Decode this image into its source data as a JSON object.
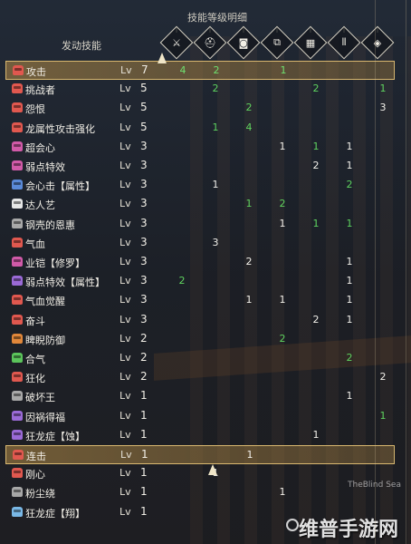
{
  "header": {
    "title": "技能等级明细",
    "column_label": "发动技能",
    "equipment_icons": [
      "weapon-icon",
      "head-armor-icon",
      "chest-armor-icon",
      "arm-armor-icon",
      "waist-armor-icon",
      "leg-armor-icon",
      "charm-icon"
    ]
  },
  "colors": {
    "accent": "#d9b870",
    "green_value": "#5fd35f",
    "white_value": "#f2f0ea",
    "icon_red": "#e0584f",
    "icon_pink": "#d05aa8",
    "icon_purple": "#9a6ad6",
    "icon_blue": "#5a8ad8",
    "icon_white": "#e6e6e6",
    "icon_gray": "#a8a8a8",
    "icon_green": "#5bc45b",
    "icon_yellow": "#e6c35a",
    "icon_orange": "#e0873a",
    "icon_lightblue": "#7ab8e6"
  },
  "lv_label": "Lv",
  "skills": [
    {
      "name": "攻击",
      "icon": "red",
      "level": "7",
      "selected": true,
      "cells": [
        [
          "4",
          "green"
        ],
        [
          "2",
          "green"
        ],
        [
          "",
          ""
        ],
        [
          "1",
          "green"
        ],
        [
          "",
          ""
        ],
        [
          "",
          ""
        ],
        [
          "",
          ""
        ]
      ]
    },
    {
      "name": "挑战者",
      "icon": "red",
      "level": "5",
      "selected": false,
      "cells": [
        [
          "",
          ""
        ],
        [
          "2",
          "green"
        ],
        [
          "",
          ""
        ],
        [
          "",
          ""
        ],
        [
          "2",
          "green"
        ],
        [
          "",
          ""
        ],
        [
          "1",
          "green"
        ]
      ]
    },
    {
      "name": "怨恨",
      "icon": "red",
      "level": "5",
      "selected": false,
      "cells": [
        [
          "",
          ""
        ],
        [
          "",
          ""
        ],
        [
          "2",
          "green"
        ],
        [
          "",
          ""
        ],
        [
          "",
          ""
        ],
        [
          "",
          ""
        ],
        [
          "3",
          "white"
        ]
      ]
    },
    {
      "name": "龙属性攻击强化",
      "icon": "red",
      "level": "5",
      "selected": false,
      "cells": [
        [
          "",
          ""
        ],
        [
          "1",
          "green"
        ],
        [
          "4",
          "green"
        ],
        [
          "",
          ""
        ],
        [
          "",
          ""
        ],
        [
          "",
          ""
        ],
        [
          "",
          ""
        ]
      ]
    },
    {
      "name": "超会心",
      "icon": "pink",
      "level": "3",
      "selected": false,
      "cells": [
        [
          "",
          ""
        ],
        [
          "",
          ""
        ],
        [
          "",
          ""
        ],
        [
          "1",
          "white"
        ],
        [
          "1",
          "green"
        ],
        [
          "1",
          "white"
        ],
        [
          "",
          ""
        ]
      ]
    },
    {
      "name": "弱点特效",
      "icon": "pink",
      "level": "3",
      "selected": false,
      "cells": [
        [
          "",
          ""
        ],
        [
          "",
          ""
        ],
        [
          "",
          ""
        ],
        [
          "",
          ""
        ],
        [
          "2",
          "white"
        ],
        [
          "1",
          "white"
        ],
        [
          "",
          ""
        ]
      ]
    },
    {
      "name": "会心击【属性】",
      "icon": "blue",
      "level": "3",
      "selected": false,
      "cells": [
        [
          "",
          ""
        ],
        [
          "1",
          "white"
        ],
        [
          "",
          ""
        ],
        [
          "",
          ""
        ],
        [
          "",
          ""
        ],
        [
          "2",
          "green"
        ],
        [
          "",
          ""
        ]
      ]
    },
    {
      "name": "达人艺",
      "icon": "white",
      "level": "3",
      "selected": false,
      "cells": [
        [
          "",
          ""
        ],
        [
          "",
          ""
        ],
        [
          "1",
          "green"
        ],
        [
          "2",
          "green"
        ],
        [
          "",
          ""
        ],
        [
          "",
          ""
        ],
        [
          "",
          ""
        ]
      ]
    },
    {
      "name": "钢壳的恩惠",
      "icon": "gray",
      "level": "3",
      "selected": false,
      "cells": [
        [
          "",
          ""
        ],
        [
          "",
          ""
        ],
        [
          "",
          ""
        ],
        [
          "1",
          "white"
        ],
        [
          "1",
          "green"
        ],
        [
          "1",
          "green"
        ],
        [
          "",
          ""
        ]
      ]
    },
    {
      "name": "气血",
      "icon": "red",
      "level": "3",
      "selected": false,
      "cells": [
        [
          "",
          ""
        ],
        [
          "3",
          "white"
        ],
        [
          "",
          ""
        ],
        [
          "",
          ""
        ],
        [
          "",
          ""
        ],
        [
          "",
          ""
        ],
        [
          "",
          ""
        ]
      ]
    },
    {
      "name": "业铠【修罗】",
      "icon": "pink",
      "level": "3",
      "selected": false,
      "cells": [
        [
          "",
          ""
        ],
        [
          "",
          ""
        ],
        [
          "2",
          "white"
        ],
        [
          "",
          ""
        ],
        [
          "",
          ""
        ],
        [
          "1",
          "white"
        ],
        [
          "",
          ""
        ]
      ]
    },
    {
      "name": "弱点特效【属性】",
      "icon": "purple",
      "level": "3",
      "selected": false,
      "cells": [
        [
          "2",
          "green"
        ],
        [
          "",
          ""
        ],
        [
          "",
          ""
        ],
        [
          "",
          ""
        ],
        [
          "",
          ""
        ],
        [
          "1",
          "white"
        ],
        [
          "",
          ""
        ]
      ]
    },
    {
      "name": "气血觉醒",
      "icon": "red",
      "level": "3",
      "selected": false,
      "cells": [
        [
          "",
          ""
        ],
        [
          "",
          ""
        ],
        [
          "1",
          "white"
        ],
        [
          "1",
          "white"
        ],
        [
          "",
          ""
        ],
        [
          "1",
          "white"
        ],
        [
          "",
          ""
        ]
      ]
    },
    {
      "name": "奋斗",
      "icon": "red",
      "level": "3",
      "selected": false,
      "cells": [
        [
          "",
          ""
        ],
        [
          "",
          ""
        ],
        [
          "",
          ""
        ],
        [
          "",
          ""
        ],
        [
          "2",
          "white"
        ],
        [
          "1",
          "white"
        ],
        [
          "",
          ""
        ]
      ]
    },
    {
      "name": "睥睨防御",
      "icon": "orange",
      "level": "2",
      "selected": false,
      "cells": [
        [
          "",
          ""
        ],
        [
          "",
          ""
        ],
        [
          "",
          ""
        ],
        [
          "2",
          "green"
        ],
        [
          "",
          ""
        ],
        [
          "",
          ""
        ],
        [
          "",
          ""
        ]
      ]
    },
    {
      "name": "合气",
      "icon": "green",
      "level": "2",
      "selected": false,
      "cells": [
        [
          "",
          ""
        ],
        [
          "",
          ""
        ],
        [
          "",
          ""
        ],
        [
          "",
          ""
        ],
        [
          "",
          ""
        ],
        [
          "2",
          "green"
        ],
        [
          "",
          ""
        ]
      ]
    },
    {
      "name": "狂化",
      "icon": "red",
      "level": "2",
      "selected": false,
      "cells": [
        [
          "",
          ""
        ],
        [
          "",
          ""
        ],
        [
          "",
          ""
        ],
        [
          "",
          ""
        ],
        [
          "",
          ""
        ],
        [
          "",
          ""
        ],
        [
          "2",
          "white"
        ]
      ]
    },
    {
      "name": "破坏王",
      "icon": "gray",
      "level": "1",
      "selected": false,
      "cells": [
        [
          "",
          ""
        ],
        [
          "",
          ""
        ],
        [
          "",
          ""
        ],
        [
          "",
          ""
        ],
        [
          "",
          ""
        ],
        [
          "1",
          "white"
        ],
        [
          "",
          ""
        ]
      ]
    },
    {
      "name": "因祸得福",
      "icon": "purple",
      "level": "1",
      "selected": false,
      "cells": [
        [
          "",
          ""
        ],
        [
          "",
          ""
        ],
        [
          "",
          ""
        ],
        [
          "",
          ""
        ],
        [
          "",
          ""
        ],
        [
          "",
          ""
        ],
        [
          "1",
          "green"
        ]
      ]
    },
    {
      "name": "狂龙症【蚀】",
      "icon": "purple",
      "level": "1",
      "selected": false,
      "cells": [
        [
          "",
          ""
        ],
        [
          "",
          ""
        ],
        [
          "",
          ""
        ],
        [
          "",
          ""
        ],
        [
          "1",
          "white"
        ],
        [
          "",
          ""
        ],
        [
          "",
          ""
        ]
      ]
    },
    {
      "name": "连击",
      "icon": "red",
      "level": "1",
      "selected": true,
      "cells": [
        [
          "",
          ""
        ],
        [
          "",
          ""
        ],
        [
          "1",
          "white"
        ],
        [
          "",
          ""
        ],
        [
          "",
          ""
        ],
        [
          "",
          ""
        ],
        [
          "",
          ""
        ]
      ]
    },
    {
      "name": "刚心",
      "icon": "red",
      "level": "1",
      "selected": false,
      "cells": [
        [
          "",
          ""
        ],
        [
          "1",
          "white"
        ],
        [
          "",
          ""
        ],
        [
          "",
          ""
        ],
        [
          "",
          ""
        ],
        [
          "",
          ""
        ],
        [
          "",
          ""
        ]
      ]
    },
    {
      "name": "粉尘绕",
      "icon": "gray",
      "level": "1",
      "selected": false,
      "cells": [
        [
          "",
          ""
        ],
        [
          "",
          ""
        ],
        [
          "",
          ""
        ],
        [
          "1",
          "white"
        ],
        [
          "",
          ""
        ],
        [
          "",
          ""
        ],
        [
          "",
          ""
        ]
      ]
    },
    {
      "name": "狂龙症【翔】",
      "icon": "lightblue",
      "level": "1",
      "selected": false,
      "cells": [
        [
          "",
          ""
        ],
        [
          "",
          ""
        ],
        [
          "",
          ""
        ],
        [
          "",
          ""
        ],
        [
          "",
          ""
        ],
        [
          "",
          ""
        ],
        [
          "",
          ""
        ]
      ]
    }
  ],
  "watermark": {
    "text": "维普手游网",
    "small": "TheBlind Sea"
  }
}
